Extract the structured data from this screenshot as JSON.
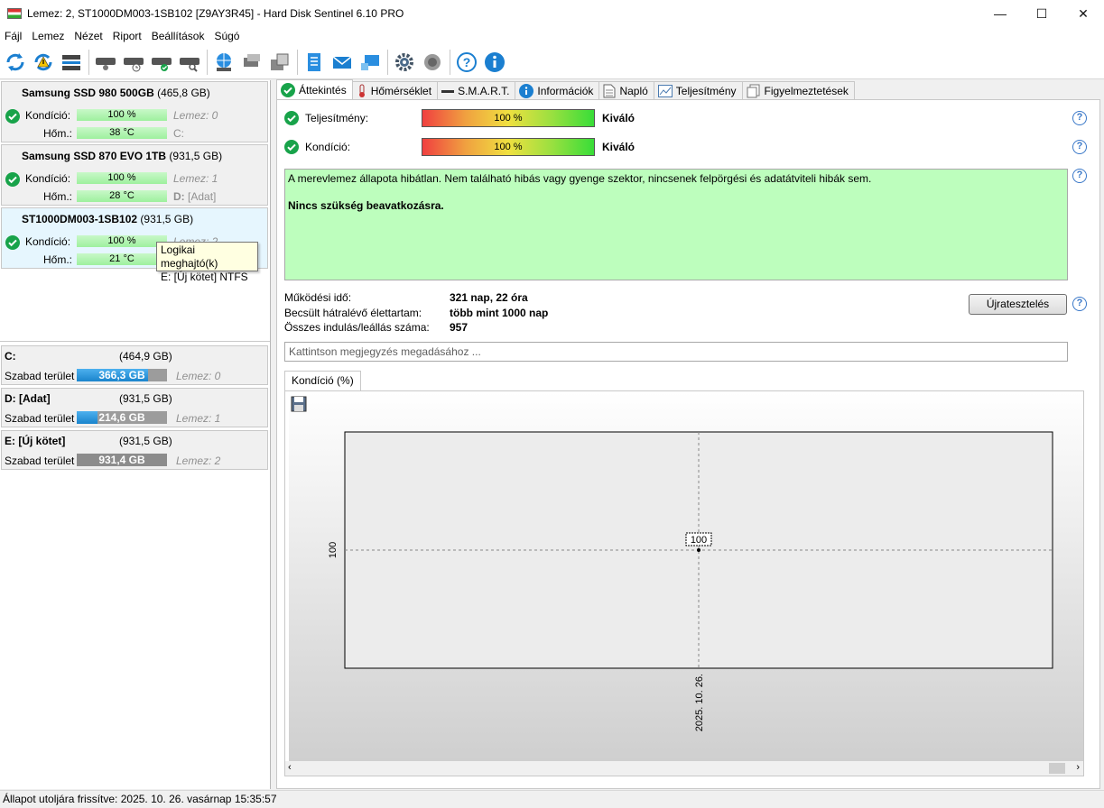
{
  "window": {
    "title": "Lemez: 2, ST1000DM003-1SB102 [Z9AY3R45]  -  Hard Disk Sentinel 6.10 PRO",
    "minimize": "—",
    "maximize": "☐",
    "close": "✕"
  },
  "menu": [
    "Fájl",
    "Lemez",
    "Nézet",
    "Riport",
    "Beállítások",
    "Súgó"
  ],
  "disks": [
    {
      "name": "Samsung SSD 980 500GB",
      "size": "(465,8 GB)",
      "condition_label": "Kondíció:",
      "condition": "100 %",
      "condition_pct": 100,
      "temp_label": "Hőm.:",
      "temp": "38 °C",
      "disk_ref": "Lemez: 0",
      "drive": "C:"
    },
    {
      "name": "Samsung SSD 870 EVO 1TB",
      "size": "(931,5 GB)",
      "condition_label": "Kondíció:",
      "condition": "100 %",
      "condition_pct": 100,
      "temp_label": "Hőm.:",
      "temp": "28 °C",
      "disk_ref": "Lemez: 1",
      "drive": "D:",
      "drive_extra": "[Adat]"
    },
    {
      "name": "ST1000DM003-1SB102",
      "size": "(931,5 GB)",
      "condition_label": "Kondíció:",
      "condition": "100 %",
      "condition_pct": 100,
      "temp_label": "Hőm.:",
      "temp": "21 °C",
      "disk_ref": "Lemez: 2",
      "drive": "E:"
    }
  ],
  "tooltip": {
    "line1": "Logikai meghajtó(k)",
    "line2": "E: [Új kötet] NTFS"
  },
  "volumes": [
    {
      "name": "C:",
      "size": "(464,9 GB)",
      "free_label": "Szabad terület",
      "free": "366,3 GB",
      "free_pct": 79,
      "disk_ref": "Lemez: 0"
    },
    {
      "name": "D: [Adat]",
      "size": "(931,5 GB)",
      "free_label": "Szabad terület",
      "free": "214,6 GB",
      "free_pct": 23,
      "disk_ref": "Lemez: 1"
    },
    {
      "name": "E: [Új kötet]",
      "size": "(931,5 GB)",
      "free_label": "Szabad terület",
      "free": "931,4 GB",
      "free_pct": 100,
      "disk_ref": "Lemez: 2"
    }
  ],
  "tabs": [
    "Áttekintés",
    "Hőmérséklet",
    "S.M.A.R.T.",
    "Információk",
    "Napló",
    "Teljesítmény",
    "Figyelmeztetések"
  ],
  "overview": {
    "performance_label": "Teljesítmény:",
    "performance_value": "100 %",
    "performance_rating": "Kiváló",
    "condition_label": "Kondíció:",
    "condition_value": "100 %",
    "condition_rating": "Kiváló",
    "status_text": "A merevlemez állapota hibátlan. Nem található hibás vagy gyenge szektor, nincsenek felpörgési és adatátviteli hibák sem.",
    "action_text": "Nincs szükség beavatkozásra.",
    "uptime_label": "Működési idő:",
    "uptime_value": "321 nap, 22 óra",
    "lifetime_label": "Becsült hátralévő élettartam:",
    "lifetime_value": "több mint 1000 nap",
    "starts_label": "Összes indulás/leállás száma:",
    "starts_value": "957",
    "retest_button": "Újratesztelés",
    "note_placeholder": "Kattintson megjegyzés megadásához ...",
    "help": "?"
  },
  "chart_tab": "Kondíció  (%)",
  "chart_data": {
    "type": "line",
    "x": [
      "2025. 10. 26."
    ],
    "series": [
      {
        "values": [
          100
        ]
      }
    ],
    "xlabel": "",
    "ylabel": "",
    "y_ticks": [
      "100"
    ],
    "data_labels": [
      "100"
    ],
    "grid": true
  },
  "statusbar": "Állapot utoljára frissítve: 2025. 10. 26. vasárnap 15:35:57",
  "colors": {
    "status_ok": "#bdfebd",
    "volume_fill": "#1a84cc",
    "check_green": "#18a34a"
  }
}
